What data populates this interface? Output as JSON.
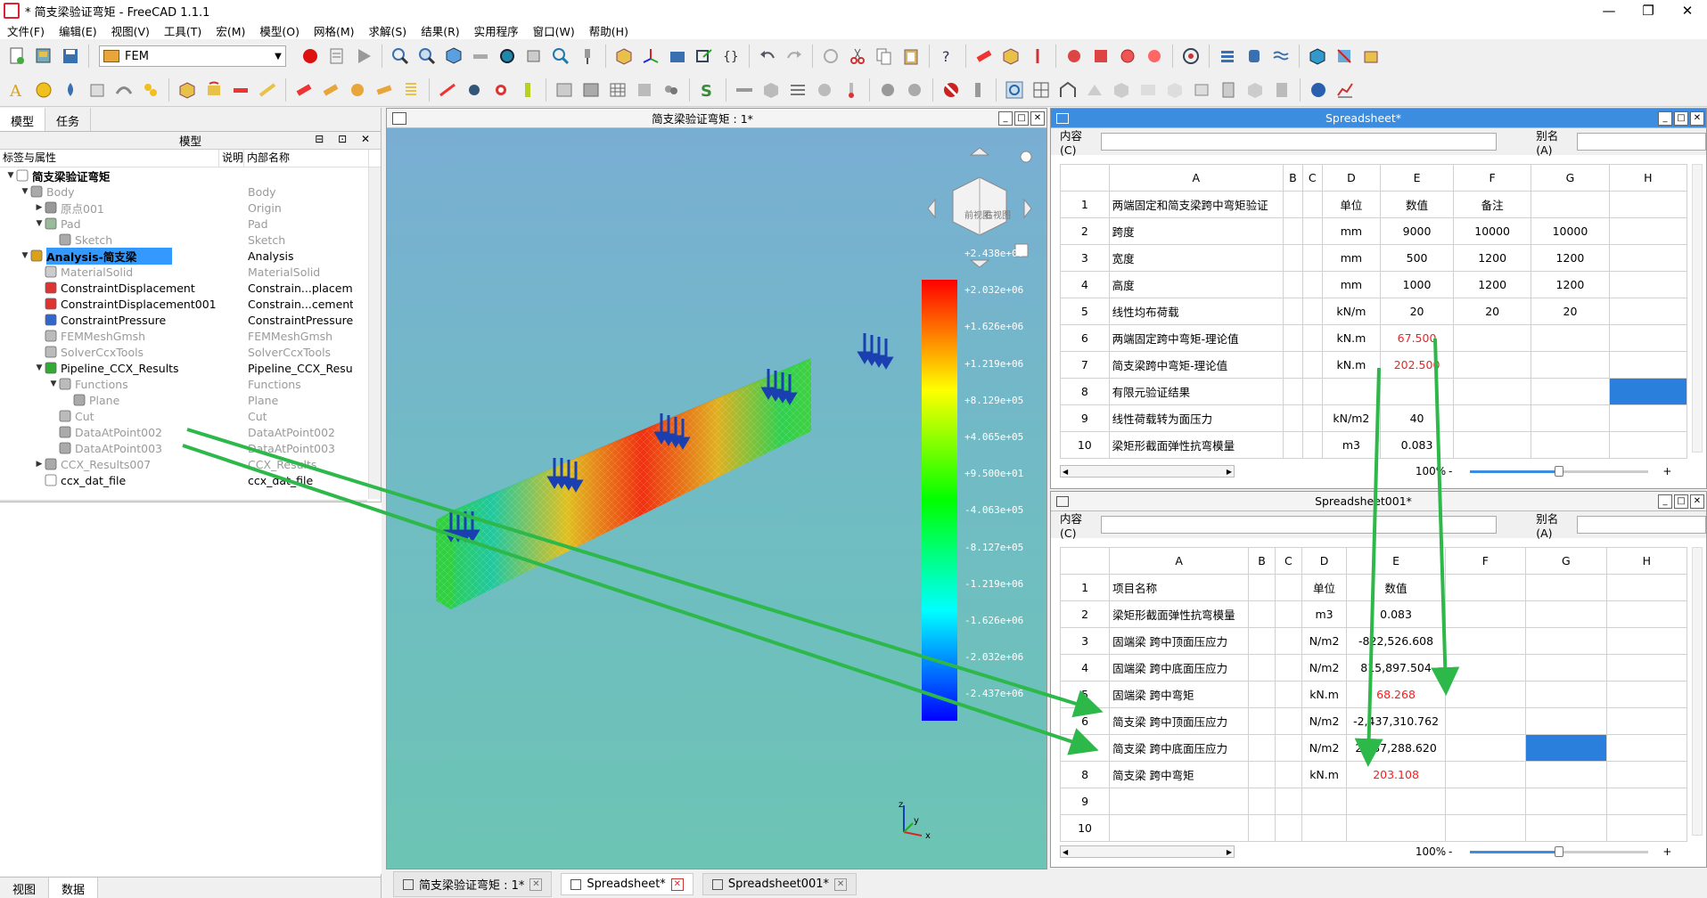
{
  "window": {
    "title": "* 简支梁验证弯矩 - FreeCAD 1.1.1",
    "minimize": "—",
    "restore": "❐",
    "close": "✕"
  },
  "menu": [
    "文件(F)",
    "编辑(E)",
    "视图(V)",
    "工具(T)",
    "宏(M)",
    "模型(O)",
    "网格(M)",
    "求解(S)",
    "结果(R)",
    "实用程序",
    "窗口(W)",
    "帮助(H)"
  ],
  "workbench": {
    "selected": "FEM"
  },
  "left_panel": {
    "tabs": [
      "模型",
      "任务"
    ],
    "header": "模型",
    "columns": [
      "标签与属性",
      "说明",
      "内部名称"
    ],
    "tree": [
      {
        "label": "简支梁验证弯矩",
        "internal": "",
        "level": 0,
        "expand": "▼",
        "icon": "document-icon",
        "state": "bold"
      },
      {
        "label": "Body",
        "internal": "Body",
        "level": 1,
        "expand": "▼",
        "icon": "body-icon",
        "state": "dim"
      },
      {
        "label": "原点001",
        "internal": "Origin",
        "level": 2,
        "expand": "▶",
        "icon": "origin-icon",
        "state": "dim"
      },
      {
        "label": "Pad",
        "internal": "Pad",
        "level": 2,
        "expand": "▼",
        "icon": "pad-icon",
        "state": "dim"
      },
      {
        "label": "Sketch",
        "internal": "Sketch",
        "level": 3,
        "expand": "",
        "icon": "sketch-icon",
        "state": "dim"
      },
      {
        "label": "Analysis-简支梁",
        "internal": "Analysis",
        "level": 1,
        "expand": "▼",
        "icon": "analysis-icon",
        "state": "sel"
      },
      {
        "label": "MaterialSolid",
        "internal": "MaterialSolid",
        "level": 2,
        "expand": "",
        "icon": "material-icon",
        "state": "dim"
      },
      {
        "label": "ConstraintDisplacement",
        "internal": "Constrain...placement",
        "level": 2,
        "expand": "",
        "icon": "displacement-icon",
        "state": ""
      },
      {
        "label": "ConstraintDisplacement001",
        "internal": "Constrain...cement001",
        "level": 2,
        "expand": "",
        "icon": "displacement-icon",
        "state": ""
      },
      {
        "label": "ConstraintPressure",
        "internal": "ConstraintPressure",
        "level": 2,
        "expand": "",
        "icon": "pressure-icon",
        "state": ""
      },
      {
        "label": "FEMMeshGmsh",
        "internal": "FEMMeshGmsh",
        "level": 2,
        "expand": "",
        "icon": "mesh-icon",
        "state": "dim"
      },
      {
        "label": "SolverCcxTools",
        "internal": "SolverCcxTools",
        "level": 2,
        "expand": "",
        "icon": "solver-icon",
        "state": "dim"
      },
      {
        "label": "Pipeline_CCX_Results",
        "internal": "Pipeline_CCX_Results",
        "level": 2,
        "expand": "▼",
        "icon": "pipeline-icon",
        "state": ""
      },
      {
        "label": "Functions",
        "internal": "Functions",
        "level": 3,
        "expand": "▼",
        "icon": "folder-icon",
        "state": "dim"
      },
      {
        "label": "Plane",
        "internal": "Plane",
        "level": 4,
        "expand": "",
        "icon": "plane-icon",
        "state": "dim"
      },
      {
        "label": "Cut",
        "internal": "Cut",
        "level": 3,
        "expand": "",
        "icon": "cut-icon",
        "state": "dim"
      },
      {
        "label": "DataAtPoint002",
        "internal": "DataAtPoint002",
        "level": 3,
        "expand": "",
        "icon": "datapoint-icon",
        "state": "dim"
      },
      {
        "label": "DataAtPoint003",
        "internal": "DataAtPoint003",
        "level": 3,
        "expand": "",
        "icon": "datapoint-icon",
        "state": "dim"
      },
      {
        "label": "CCX_Results007",
        "internal": "CCX_Results",
        "level": 2,
        "expand": "▶",
        "icon": "results-icon",
        "state": "dim"
      },
      {
        "label": "ccx_dat_file",
        "internal": "ccx_dat_file",
        "level": 2,
        "expand": "",
        "icon": "text-file-icon",
        "state": ""
      }
    ],
    "bottom_tabs": [
      "视图",
      "数据"
    ]
  },
  "view3d": {
    "title": "简支梁验证弯矩 : 1*",
    "colorbar_labels": [
      "+2.438e+06",
      "+2.032e+06",
      "+1.626e+06",
      "+1.219e+06",
      "+8.129e+05",
      "+4.065e+05",
      "+9.500e+01",
      "-4.063e+05",
      "-8.127e+05",
      "-1.219e+06",
      "-1.626e+06",
      "-2.032e+06",
      "-2.437e+06"
    ],
    "navcube_face_front": "前视图",
    "navcube_face_right": "右视图",
    "navcube_face_top": "俯视图",
    "axis_labels": [
      "z",
      "y",
      "x"
    ]
  },
  "sheet1": {
    "title": "Spreadsheet*",
    "content_label": "内容(C)",
    "alias_label": "别名(A)",
    "columns": [
      "A",
      "B",
      "C",
      "D",
      "E",
      "F",
      "G",
      "H"
    ],
    "rows": [
      [
        "1",
        "两端固定和简支梁跨中弯矩验证",
        "",
        "",
        "单位",
        "数值",
        "备注",
        "",
        ""
      ],
      [
        "2",
        "跨度",
        "",
        "",
        "mm",
        "9000",
        "10000",
        "10000",
        ""
      ],
      [
        "3",
        "宽度",
        "",
        "",
        "mm",
        "500",
        "1200",
        "1200",
        ""
      ],
      [
        "4",
        "高度",
        "",
        "",
        "mm",
        "1000",
        "1200",
        "1200",
        ""
      ],
      [
        "5",
        "线性均布荷载",
        "",
        "",
        "kN/m",
        "20",
        "20",
        "20",
        ""
      ],
      [
        "6",
        "两端固定跨中弯矩-理论值",
        "",
        "",
        "kN.m",
        "67.500",
        "",
        "",
        ""
      ],
      [
        "7",
        "简支梁跨中弯矩-理论值",
        "",
        "",
        "kN.m",
        "202.500",
        "",
        "",
        ""
      ],
      [
        "8",
        "有限元验证结果",
        "",
        "",
        "",
        "",
        "",
        "",
        ""
      ],
      [
        "9",
        "线性荷载转为面压力",
        "",
        "",
        "kN/m2",
        "40",
        "",
        "",
        ""
      ],
      [
        "10",
        "梁矩形截面弹性抗弯模量",
        "",
        "",
        "m3",
        "0.083",
        "",
        "",
        ""
      ]
    ],
    "zoom": "100%",
    "zoom_value": 0.5
  },
  "sheet2": {
    "title": "Spreadsheet001*",
    "content_label": "内容(C)",
    "alias_label": "别名(A)",
    "columns": [
      "A",
      "B",
      "C",
      "D",
      "E",
      "F",
      "G",
      "H"
    ],
    "rows": [
      [
        "1",
        "项目名称",
        "",
        "",
        "单位",
        "数值",
        "",
        "",
        ""
      ],
      [
        "2",
        "梁矩形截面弹性抗弯模量",
        "",
        "",
        "m3",
        "0.083",
        "",
        "",
        ""
      ],
      [
        "3",
        "固端梁 跨中顶面压应力",
        "",
        "",
        "N/m2",
        "-822,526.608",
        "",
        "",
        ""
      ],
      [
        "4",
        "固端梁 跨中底面压应力",
        "",
        "",
        "N/m2",
        "815,897.504",
        "",
        "",
        ""
      ],
      [
        "5",
        "固端梁 跨中弯矩",
        "",
        "",
        "kN.m",
        "68.268",
        "",
        "",
        ""
      ],
      [
        "6",
        "简支梁 跨中顶面压应力",
        "",
        "",
        "N/m2",
        "-2,437,310.762",
        "",
        "",
        ""
      ],
      [
        "7",
        "简支梁 跨中底面压应力",
        "",
        "",
        "N/m2",
        "2,437,288.620",
        "",
        "",
        ""
      ],
      [
        "8",
        "简支梁 跨中弯矩",
        "",
        "",
        "kN.m",
        "203.108",
        "",
        "",
        ""
      ],
      [
        "9",
        "",
        "",
        "",
        "",
        "",
        "",
        "",
        ""
      ],
      [
        "10",
        "",
        "",
        "",
        "",
        "",
        "",
        "",
        ""
      ]
    ],
    "zoom": "100%",
    "zoom_value": 0.5
  },
  "doc_tabs": [
    {
      "label": "简支梁验证弯矩 : 1*",
      "icon": "document-icon"
    },
    {
      "label": "Spreadsheet*",
      "icon": "spreadsheet-icon"
    },
    {
      "label": "Spreadsheet001*",
      "icon": "spreadsheet-icon"
    }
  ],
  "colors": {
    "accent": "#3c8de0",
    "selection": "#2b7fdc",
    "red_value": "#ff1a1a",
    "arrow_green": "#2db84a"
  }
}
